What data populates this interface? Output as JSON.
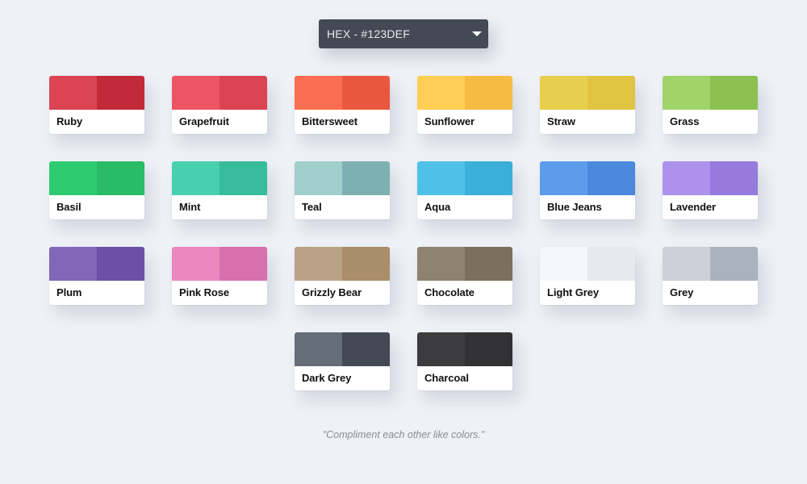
{
  "format_select": {
    "label": "HEX - #123DEF"
  },
  "colors": [
    {
      "name": "Ruby",
      "light": "#DA4453",
      "dark": "#C12A3A"
    },
    {
      "name": "Grapefruit",
      "light": "#ED5565",
      "dark": "#DA4453"
    },
    {
      "name": "Bittersweet",
      "light": "#FC6E51",
      "dark": "#E9573F"
    },
    {
      "name": "Sunflower",
      "light": "#FFCE54",
      "dark": "#F6BB42"
    },
    {
      "name": "Straw",
      "light": "#E8CE4D",
      "dark": "#E0C341"
    },
    {
      "name": "Grass",
      "light": "#A0D468",
      "dark": "#8CC152"
    },
    {
      "name": "Basil",
      "light": "#2ECC71",
      "dark": "#29BB66"
    },
    {
      "name": "Mint",
      "light": "#48CFAD",
      "dark": "#37BC9B"
    },
    {
      "name": "Teal",
      "light": "#A0CECB",
      "dark": "#7DB1B1"
    },
    {
      "name": "Aqua",
      "light": "#4FC1E9",
      "dark": "#3BAFDA"
    },
    {
      "name": "Blue Jeans",
      "light": "#5D9CEC",
      "dark": "#4A89DC"
    },
    {
      "name": "Lavender",
      "light": "#AC92EC",
      "dark": "#967ADC"
    },
    {
      "name": "Plum",
      "light": "#8067B7",
      "dark": "#6A50A7"
    },
    {
      "name": "Pink Rose",
      "light": "#EC87C0",
      "dark": "#D770AD"
    },
    {
      "name": "Grizzly Bear",
      "light": "#BAA286",
      "dark": "#AA8E69"
    },
    {
      "name": "Chocolate",
      "light": "#8E8271",
      "dark": "#7B6F5E"
    },
    {
      "name": "Light Grey",
      "light": "#F5F7FA",
      "dark": "#E6E9ED"
    },
    {
      "name": "Grey",
      "light": "#CCD1D9",
      "dark": "#AAB2BD"
    },
    {
      "name": "Dark Grey",
      "light": "#656D78",
      "dark": "#434A54"
    },
    {
      "name": "Charcoal",
      "light": "#3C3B3D",
      "dark": "#323133"
    }
  ],
  "quote": "\"Compliment each other like colors.\""
}
